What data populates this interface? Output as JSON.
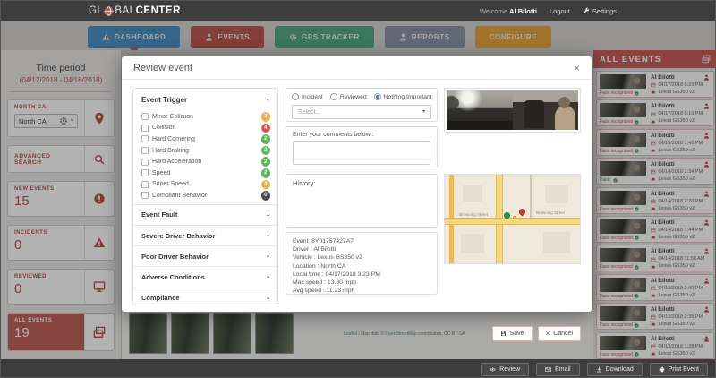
{
  "header": {
    "brand_gl": "GL",
    "brand_bal": "BAL",
    "brand_center": "CENTER",
    "welcome": "Welcome",
    "user": "Al Bilotti",
    "logout": "Logout",
    "settings": "Settings"
  },
  "nav": [
    {
      "label": "DASHBOARD",
      "color": "#4f93c8"
    },
    {
      "label": "EVENTS",
      "color": "#bf5a52"
    },
    {
      "label": "GPS TRACKER",
      "color": "#55a98c"
    },
    {
      "label": "REPORTS",
      "color": "#8b97ab"
    },
    {
      "label": "CONFIGURE",
      "color": "#e9a53f"
    }
  ],
  "sidebar": {
    "time_period_label": "Time period",
    "time_period_value": "(04/12/2018 - 04/18/2018)",
    "fleet_label": "NORTH CA",
    "fleet_value": "North CA",
    "advanced_search_label": "ADVANCED SEARCH",
    "new_events_label": "NEW EVENTS",
    "new_events_value": "15",
    "incidents_label": "INCIDENTS",
    "incidents_value": "0",
    "reviewed_label": "REVIEWED",
    "reviewed_value": "0",
    "all_events_label": "ALL EVENTS",
    "all_events_value": "19"
  },
  "modal": {
    "title": "Review event",
    "trigger_header": "Event Trigger",
    "triggers": [
      {
        "label": "Minor Collision",
        "count": "3",
        "color": "#f0ad4e"
      },
      {
        "label": "Collision",
        "count": "4",
        "color": "#d9534f"
      },
      {
        "label": "Hard Cornering",
        "count": "2",
        "color": "#5cb85c"
      },
      {
        "label": "Hard Braking",
        "count": "2",
        "color": "#5cb85c"
      },
      {
        "label": "Hard Acceleration",
        "count": "2",
        "color": "#5cb85c"
      },
      {
        "label": "Speed",
        "count": "2",
        "color": "#5cb85c"
      },
      {
        "label": "Super Speed",
        "count": "3",
        "color": "#f0ad4e"
      },
      {
        "label": "Compliant Behavior",
        "count": "0",
        "color": "#4a4e52"
      }
    ],
    "accordions": [
      {
        "label": "Event Fault"
      },
      {
        "label": "Severe Driver Behavior"
      },
      {
        "label": "Poor Driver Behavior"
      },
      {
        "label": "Adverse Conditions"
      },
      {
        "label": "Compliance"
      }
    ],
    "radios": [
      {
        "label": "Incident",
        "dot": ""
      },
      {
        "label": "Reviewed",
        "dot": ""
      },
      {
        "label": "Nothing Important",
        "dot": "#2e7cd6"
      }
    ],
    "select_placeholder": "Select...",
    "comments_label": "Enter your comments below :",
    "history_label": "History:",
    "details": [
      "Event: 8Y01757427A7",
      "Driver : Al Bilotti",
      "Vehicle : Lexus GS350 v2",
      "Location : North CA",
      "Local time : 04/17/2018 3:23 PM",
      "Max speed : 13.80 mph",
      "Avg speed : 11.23 mph"
    ],
    "save_label": "Save",
    "cancel_label": "Cancel",
    "map": {
      "street_left": "Browning Street",
      "street_right": "Browning Street"
    }
  },
  "events_panel": {
    "title": "ALL EVENTS",
    "events": [
      {
        "name": "Al Bilotti",
        "date": "04/17/2018 5:23 PM",
        "vehicle": "Lexus GS350 v2",
        "tag": "Face recognized",
        "tag_color": "#b9534e"
      },
      {
        "name": "Al Bilotti",
        "date": "04/17/2018 5:16 PM",
        "vehicle": "Lexus GS350 v2",
        "tag": "Face recognized",
        "tag_color": "#b9534e"
      },
      {
        "name": "Al Bilotti",
        "date": "04/15/2018 1:46 PM",
        "vehicle": "Lexus GS350 v2",
        "tag": "Face recognized",
        "tag_color": "#b9534e"
      },
      {
        "name": "Al Bilotti",
        "date": "04/14/2018 2:34 PM",
        "vehicle": "Lexus GS350 v2",
        "tag": "Panic",
        "tag_color": "#3d9b4f"
      },
      {
        "name": "Al Bilotti",
        "date": "04/14/2018 2:20 PM",
        "vehicle": "Lexus GS350 v2",
        "tag": "Face recognized",
        "tag_color": "#b9534e"
      },
      {
        "name": "Al Bilotti",
        "date": "04/14/2018 1:44 PM",
        "vehicle": "Lexus GS350 v2",
        "tag": "Face recognized",
        "tag_color": "#b9534e"
      },
      {
        "name": "Al Bilotti",
        "date": "04/14/2018 11:58 AM",
        "vehicle": "Lexus GS350 v2",
        "tag": "Face recognized",
        "tag_color": "#b9534e"
      },
      {
        "name": "Al Bilotti",
        "date": "04/13/2018 2:40 PM",
        "vehicle": "Lexus GS350 v2",
        "tag": "Face recognized",
        "tag_color": "#b9534e"
      },
      {
        "name": "Al Bilotti",
        "date": "04/13/2018 2:35 PM",
        "vehicle": "Lexus GS350 v2",
        "tag": "Face recognized",
        "tag_color": "#b9534e"
      },
      {
        "name": "Al Bilotti",
        "date": "04/13/2018 1:28 PM",
        "vehicle": "Lexus GS350 v2",
        "tag": "Face recognized",
        "tag_color": "#b9534e"
      }
    ]
  },
  "footer": {
    "review": "Review",
    "email": "Email",
    "download": "Download",
    "print": "Print Event"
  },
  "background": {
    "leaflet": "Leaflet",
    "map_data": " | Map data © ",
    "osm": "OpenStreetMap",
    "suffix": " contributors, CC-BY-SA"
  },
  "icons": {
    "caret_down": "▾",
    "caret_up": "▴",
    "close": "×",
    "cancel_x": "×"
  }
}
